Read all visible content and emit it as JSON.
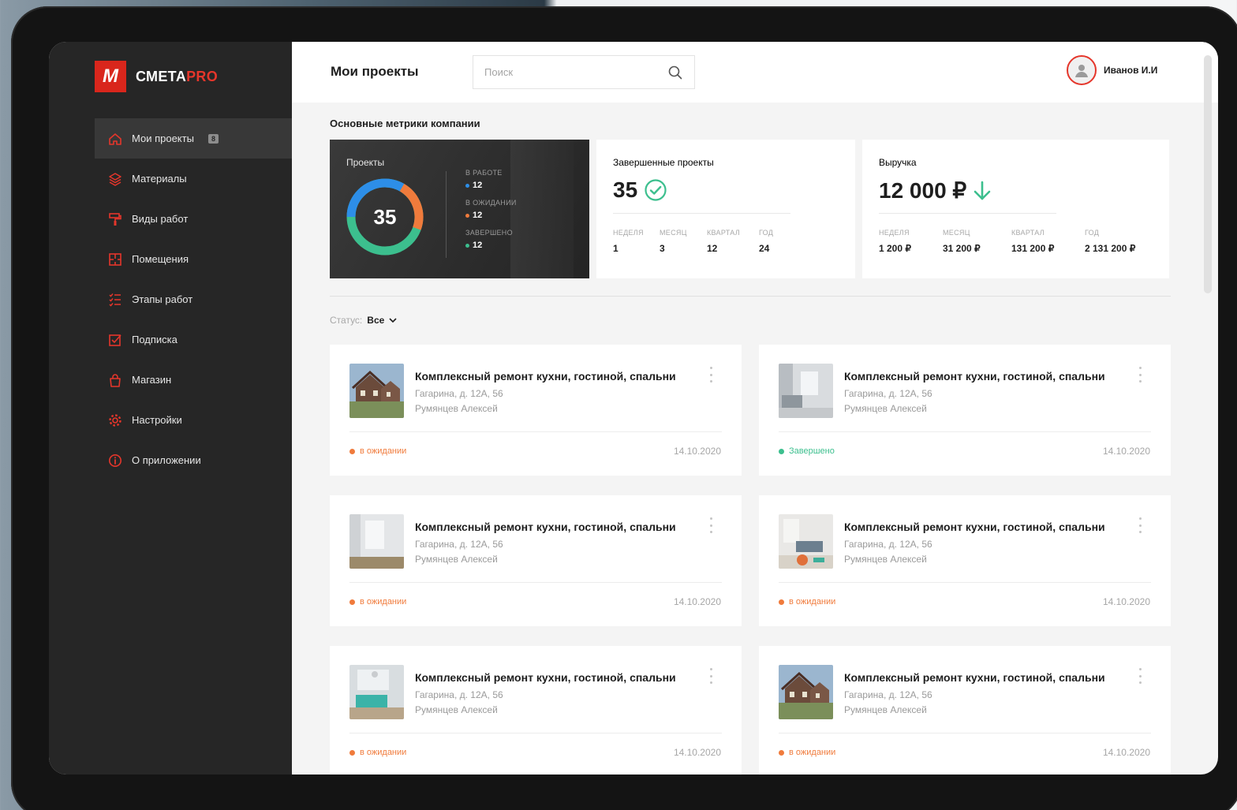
{
  "app": {
    "logo_mark": "M",
    "logo_name": "СМЕТА",
    "logo_suffix": "PRO"
  },
  "colors": {
    "accent": "#e5362b",
    "sidebar_bg": "#262626",
    "blue": "#2d8ee8",
    "orange": "#f07b3c",
    "green": "#3cbf8e"
  },
  "sidebar": {
    "items": [
      {
        "label": "Мои проекты",
        "icon": "home-icon",
        "badge": "8",
        "active": true
      },
      {
        "label": "Материалы",
        "icon": "layers-icon"
      },
      {
        "label": "Виды работ",
        "icon": "paint-roller-icon"
      },
      {
        "label": "Помещения",
        "icon": "floorplan-icon"
      },
      {
        "label": "Этапы работ",
        "icon": "checklist-icon"
      },
      {
        "label": "Подписка",
        "icon": "checkbox-icon"
      },
      {
        "label": "Магазин",
        "icon": "shopping-bag-icon"
      },
      {
        "label": "Настройки",
        "icon": "gear-icon"
      },
      {
        "label": "О приложении",
        "icon": "info-icon"
      }
    ]
  },
  "header": {
    "title": "Мои проекты",
    "search_placeholder": "Поиск",
    "user_name": "Иванов И.И"
  },
  "metrics": {
    "section_title": "Основные метрики компании",
    "projects": {
      "label": "Проекты",
      "total": "35",
      "legend": [
        {
          "label": "В РАБОТЕ",
          "value": "12",
          "color": "#2d8ee8"
        },
        {
          "label": "В ОЖИДАНИИ",
          "value": "12",
          "color": "#f07b3c"
        },
        {
          "label": "ЗАВЕРШЕНО",
          "value": "12",
          "color": "#3cbf8e"
        }
      ]
    },
    "completed": {
      "label": "Завершенные проекты",
      "value": "35",
      "periods": [
        {
          "label": "НЕДЕЛЯ",
          "value": "1"
        },
        {
          "label": "МЕСЯЦ",
          "value": "3"
        },
        {
          "label": "КВАРТАЛ",
          "value": "12"
        },
        {
          "label": "ГОД",
          "value": "24"
        }
      ]
    },
    "revenue": {
      "label": "Выручка",
      "value": "12 000 ₽",
      "periods": [
        {
          "label": "НЕДЕЛЯ",
          "value": "1 200 ₽"
        },
        {
          "label": "МЕСЯЦ",
          "value": "31 200 ₽"
        },
        {
          "label": "КВАРТАЛ",
          "value": "131 200 ₽"
        },
        {
          "label": "ГОД",
          "value": "2 131 200 ₽"
        }
      ]
    }
  },
  "filter": {
    "label": "Статус:",
    "value": "Все"
  },
  "projects": [
    {
      "title": "Комплексный ремонт кухни, гостиной, спальни",
      "address": "Гагарина, д. 12А, 56",
      "person": "Румянцев Алексей",
      "status": "в ожидании",
      "status_color": "#f07b3c",
      "date": "14.10.2020",
      "thumb": "house"
    },
    {
      "title": "Комплексный ремонт кухни, гостиной, спальни",
      "address": "Гагарина, д. 12А, 56",
      "person": "Румянцев Алексей",
      "status": "Завершено",
      "status_color": "#3cbf8e",
      "date": "14.10.2020",
      "thumb": "kitchen"
    },
    {
      "title": "Комплексный ремонт кухни, гостиной, спальни",
      "address": "Гагарина, д. 12А, 56",
      "person": "Румянцев Алексей",
      "status": "в ожидании",
      "status_color": "#f07b3c",
      "date": "14.10.2020",
      "thumb": "empty-room"
    },
    {
      "title": "Комплексный ремонт кухни, гостиной, спальни",
      "address": "Гагарина, д. 12А, 56",
      "person": "Румянцев Алексей",
      "status": "в ожидании",
      "status_color": "#f07b3c",
      "date": "14.10.2020",
      "thumb": "living-room"
    },
    {
      "title": "Комплексный ремонт кухни, гостиной, спальни",
      "address": "Гагарина, д. 12А, 56",
      "person": "Румянцев Алексей",
      "status": "в ожидании",
      "status_color": "#f07b3c",
      "date": "14.10.2020",
      "thumb": "sofa-room"
    },
    {
      "title": "Комплексный ремонт кухни, гостиной, спальни",
      "address": "Гагарина, д. 12А, 56",
      "person": "Румянцев Алексей",
      "status": "в ожидании",
      "status_color": "#f07b3c",
      "date": "14.10.2020",
      "thumb": "house"
    }
  ]
}
